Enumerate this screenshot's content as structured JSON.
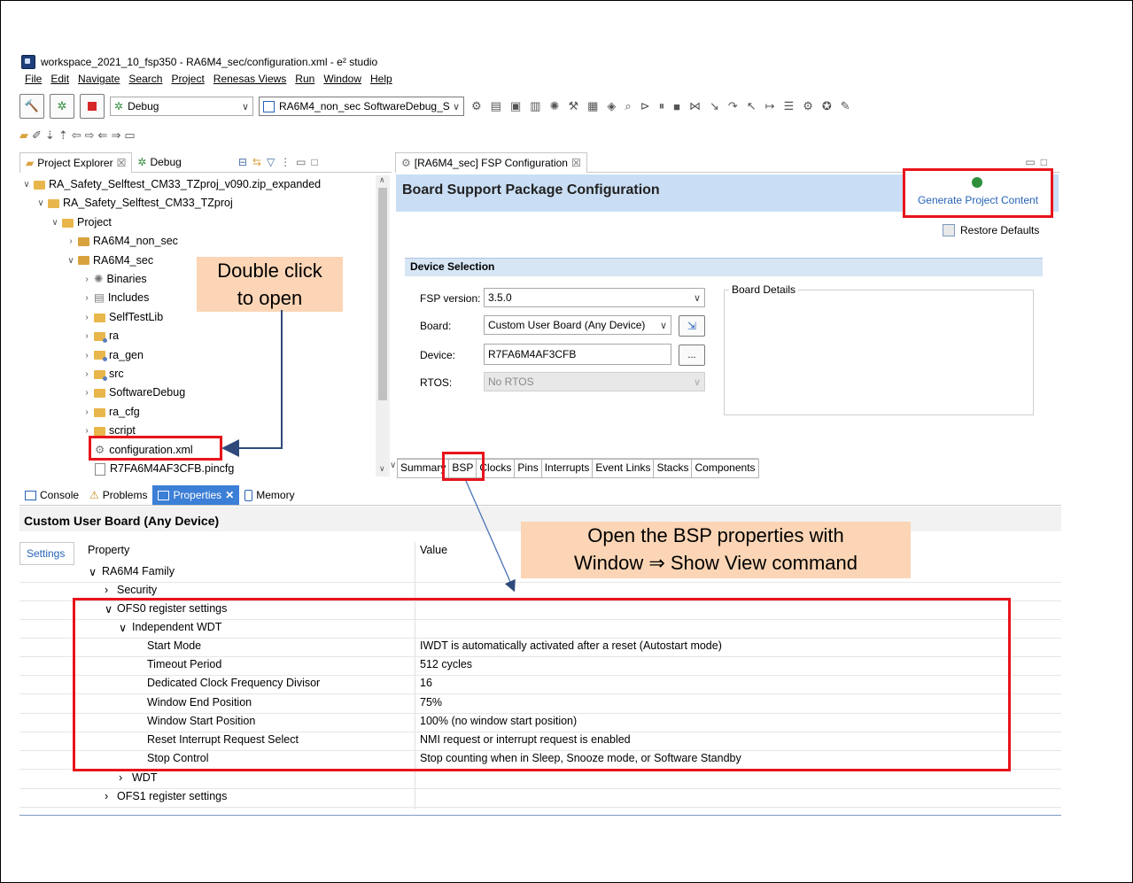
{
  "window": {
    "title": "workspace_2021_10_fsp350 - RA6M4_sec/configuration.xml - e² studio"
  },
  "menu": [
    "File",
    "Edit",
    "Navigate",
    "Search",
    "Project",
    "Renesas Views",
    "Run",
    "Window",
    "Help"
  ],
  "toolbar": {
    "debug_config": "Debug",
    "launch_config": "RA6M4_non_sec SoftwareDebug_S"
  },
  "project_explorer": {
    "tab_label": "Project Explorer",
    "debug_tab_label": "Debug",
    "tree": [
      {
        "label": "RA_Safety_Selftest_CM33_TZproj_v090.zip_expanded"
      },
      {
        "label": "RA_Safety_Selftest_CM33_TZproj"
      },
      {
        "label": "Project"
      },
      {
        "label": "RA6M4_non_sec"
      },
      {
        "label": "RA6M4_sec"
      },
      {
        "label": "Binaries"
      },
      {
        "label": "Includes"
      },
      {
        "label": "SelfTestLib"
      },
      {
        "label": "ra"
      },
      {
        "label": "ra_gen"
      },
      {
        "label": "src"
      },
      {
        "label": "SoftwareDebug"
      },
      {
        "label": "ra_cfg"
      },
      {
        "label": "script"
      },
      {
        "label": "configuration.xml"
      },
      {
        "label": "R7FA6M4AF3CFB.pincfg"
      }
    ]
  },
  "callouts": {
    "double_click_line1": "Double click",
    "double_click_line2": "to open",
    "bsp_line1": "Open the BSP properties with",
    "bsp_line2": "Window ⇒ Show View command"
  },
  "editor": {
    "tab_label": "[RA6M4_sec] FSP Configuration",
    "heading": "Board Support Package Configuration",
    "generate_button": "Generate Project Content",
    "restore_defaults": "Restore Defaults",
    "device_selection_title": "Device Selection",
    "fsp_version_label": "FSP version:",
    "fsp_version_value": "3.5.0",
    "board_label": "Board:",
    "board_value": "Custom User Board (Any Device)",
    "device_label": "Device:",
    "device_value": "R7FA6M4AF3CFB",
    "rtos_label": "RTOS:",
    "rtos_value": "No RTOS",
    "board_details_title": "Board Details",
    "browse_button": "...",
    "bottom_tabs": [
      "Summary",
      "BSP",
      "Clocks",
      "Pins",
      "Interrupts",
      "Event Links",
      "Stacks",
      "Components"
    ]
  },
  "bottom_panel": {
    "tabs": [
      "Console",
      "Problems",
      "Properties",
      "Memory"
    ],
    "heading": "Custom User Board (Any Device)",
    "settings_tab": "Settings",
    "col_property": "Property",
    "col_value": "Value",
    "rows": [
      {
        "label": "RA6M4 Family",
        "value": ""
      },
      {
        "label": "Security",
        "value": ""
      },
      {
        "label": "OFS0 register settings",
        "value": ""
      },
      {
        "label": "Independent WDT",
        "value": ""
      },
      {
        "label": "Start Mode",
        "value": "IWDT is automatically activated after a reset (Autostart mode)"
      },
      {
        "label": "Timeout Period",
        "value": "512 cycles"
      },
      {
        "label": "Dedicated Clock Frequency Divisor",
        "value": "16"
      },
      {
        "label": "Window End Position",
        "value": "75%"
      },
      {
        "label": "Window Start Position",
        "value": "100% (no window start position)"
      },
      {
        "label": "Reset Interrupt Request Select",
        "value": "NMI request or interrupt request is enabled"
      },
      {
        "label": "Stop Control",
        "value": "Stop counting when in Sleep, Snooze mode, or Software Standby"
      },
      {
        "label": "WDT",
        "value": ""
      },
      {
        "label": "OFS1 register settings",
        "value": ""
      }
    ]
  },
  "colors": {
    "highlight_red": "#e8141c",
    "callout_fill": "#fbd5b5",
    "bsp_header": "#c9def4",
    "properties_tab_active": "#3c7fd6",
    "link_blue": "#2863b8"
  }
}
